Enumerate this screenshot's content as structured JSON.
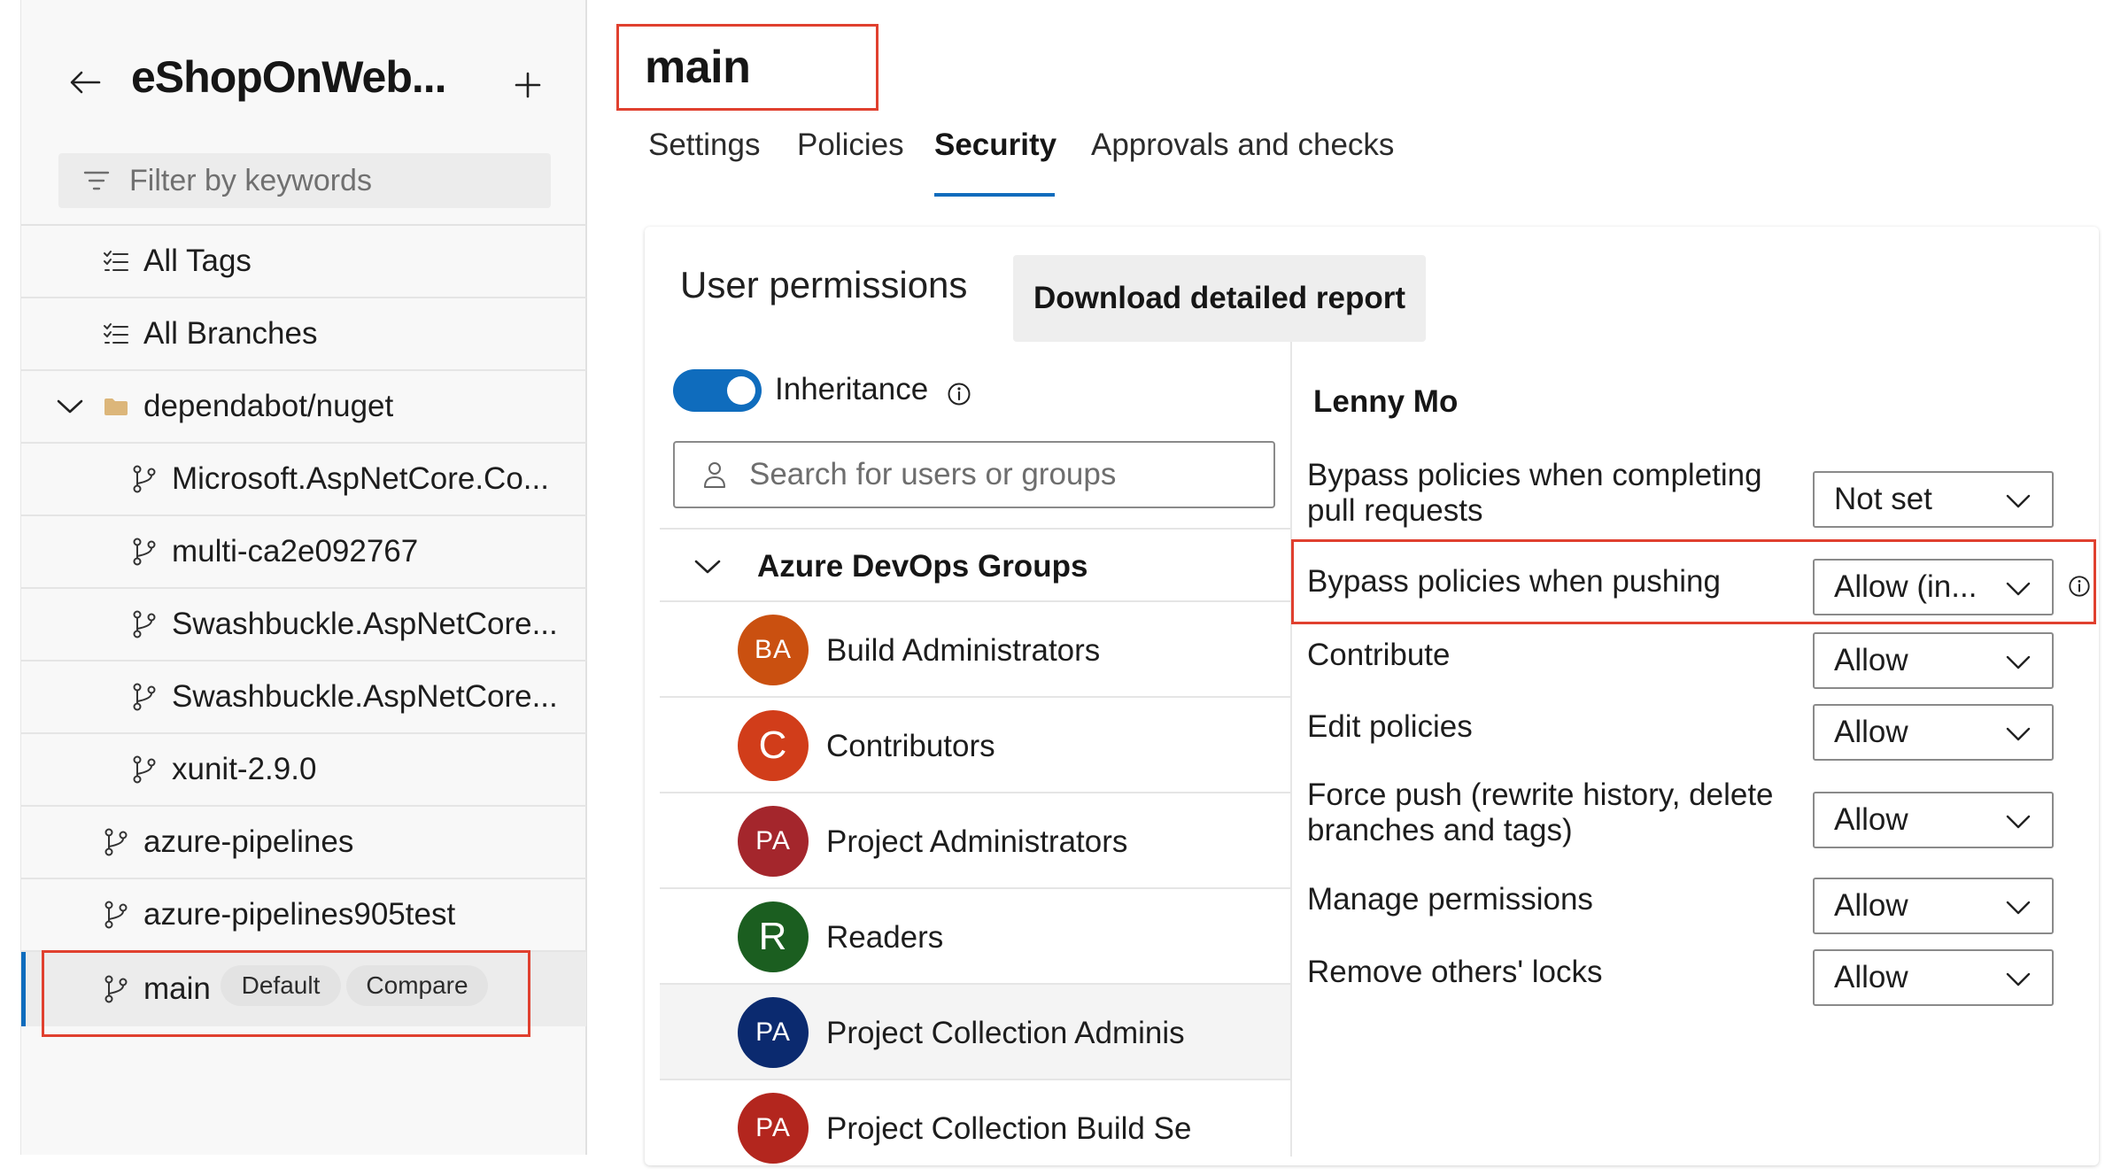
{
  "sidebar": {
    "repo_title": "eShopOnWeb...",
    "filter_placeholder": "Filter by keywords",
    "items": [
      {
        "label": "All Tags",
        "icon": "list-icon"
      },
      {
        "label": "All Branches",
        "icon": "list-icon"
      },
      {
        "label": "dependabot/nuget",
        "icon": "folder-icon"
      },
      {
        "label": "Microsoft.AspNetCore.Co...",
        "icon": "branch-icon"
      },
      {
        "label": "multi-ca2e092767",
        "icon": "branch-icon"
      },
      {
        "label": "Swashbuckle.AspNetCore...",
        "icon": "branch-icon"
      },
      {
        "label": "Swashbuckle.AspNetCore...",
        "icon": "branch-icon"
      },
      {
        "label": "xunit-2.9.0",
        "icon": "branch-icon"
      },
      {
        "label": "azure-pipelines",
        "icon": "branch-icon"
      },
      {
        "label": "azure-pipelines905test",
        "icon": "branch-icon"
      },
      {
        "label": "main",
        "icon": "branch-icon",
        "selected": true
      }
    ],
    "default_badge": "Default",
    "compare_button": "Compare"
  },
  "header": {
    "branch_title": "main",
    "tabs": [
      {
        "label": "Settings"
      },
      {
        "label": "Policies"
      },
      {
        "label": "Security",
        "active": true
      },
      {
        "label": "Approvals and checks"
      }
    ]
  },
  "security": {
    "heading": "User permissions",
    "download_button": "Download detailed report",
    "inheritance_label": "Inheritance",
    "inheritance_on": true,
    "search_placeholder": "Search for users or groups",
    "group_header": "Azure DevOps Groups",
    "members": [
      {
        "initials": "BA",
        "name": "Build Administrators",
        "color": "#ca5010"
      },
      {
        "initials": "C",
        "name": "Contributors",
        "color": "#d13d1a"
      },
      {
        "initials": "PA",
        "name": "Project Administrators",
        "color": "#a4262c"
      },
      {
        "initials": "R",
        "name": "Readers",
        "color": "#1b5e20"
      },
      {
        "initials": "PA",
        "name": "Project Collection Adminis",
        "color": "#0b2a6f"
      },
      {
        "initials": "PA",
        "name": "Project Collection Build Se",
        "color": "#b3261e"
      }
    ],
    "selected_user": "Lenny Mo",
    "permissions": [
      {
        "line1": "Bypass policies when completing",
        "line2": "pull requests",
        "value": "Not set"
      },
      {
        "line1": "Bypass policies when pushing",
        "line2": "",
        "value": "Allow (in..."
      },
      {
        "line1": "Contribute",
        "line2": "",
        "value": "Allow"
      },
      {
        "line1": "Edit policies",
        "line2": "",
        "value": "Allow"
      },
      {
        "line1": "Force push (rewrite history, delete",
        "line2": "branches and tags)",
        "value": "Allow"
      },
      {
        "line1": "Manage permissions",
        "line2": "",
        "value": "Allow"
      },
      {
        "line1": "Remove others' locks",
        "line2": "",
        "value": "Allow"
      }
    ]
  },
  "colors": {
    "accent": "#0f6cbd",
    "highlight_box": "#e0402f"
  }
}
